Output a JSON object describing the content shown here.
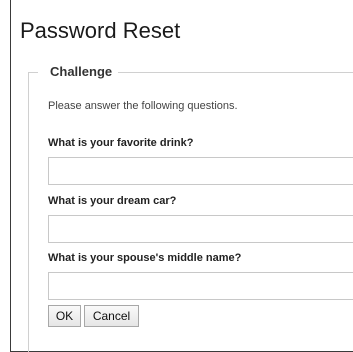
{
  "page": {
    "title": "Password Reset"
  },
  "challenge": {
    "legend": "Challenge",
    "instructions": "Please answer the following questions.",
    "questions": [
      {
        "label": "What is your favorite drink?",
        "value": ""
      },
      {
        "label": "What is your dream car?",
        "value": ""
      },
      {
        "label": "What is your spouse's middle name?",
        "value": ""
      }
    ]
  },
  "actions": {
    "ok_label": "OK",
    "cancel_label": "Cancel"
  }
}
